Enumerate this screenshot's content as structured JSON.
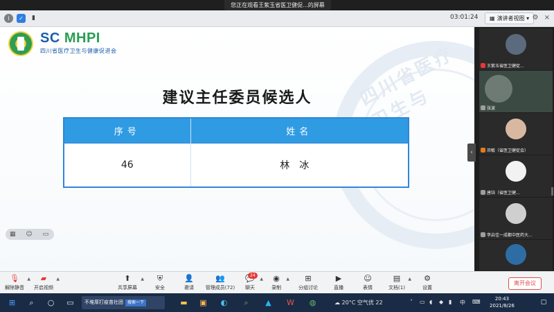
{
  "banner": {
    "text": "您正在观看王紫玉省医卫健促...的屏幕"
  },
  "topbar": {
    "timer": "03:01:24",
    "view_label": "演讲者视图"
  },
  "slide": {
    "brand_en_sc": "SC",
    "brand_en_rest": "MHPI",
    "brand_cn": "四川省医疗卫生与健康促进会",
    "watermark": "四川省医疗卫生与",
    "title": "建议主任委员候选人",
    "table": {
      "headers": [
        "序号",
        "姓名"
      ],
      "rows": [
        {
          "no": "46",
          "name": "林冰"
        }
      ]
    }
  },
  "participants": [
    {
      "name": "王紫玉省医卫健促..."
    },
    {
      "name": "张波"
    },
    {
      "name": "邓敏（省医卫健促会）"
    },
    {
      "name": "唐钰（省医卫健..."
    },
    {
      "name": "李启佳一成都中医药大..."
    },
    {
      "name": ""
    }
  ],
  "toolbar": {
    "mute": "解除静音",
    "video": "开启视频",
    "share": "共享屏幕",
    "security": "安全",
    "invite": "邀请",
    "members": "管理成员(72)",
    "chat": "聊天",
    "chat_badge": "24",
    "record": "录制",
    "breakout": "分组讨论",
    "live": "直播",
    "reactions": "表情",
    "docs": "文档(1)",
    "settings": "设置",
    "leave": "离开会议"
  },
  "taskbar": {
    "app_label": "不堆厚打疫苗社团",
    "app_chip": "搜索一下",
    "weather": "20°C 空气优 22",
    "ime": "中",
    "time": "20:43",
    "date": "2021/8/26"
  }
}
